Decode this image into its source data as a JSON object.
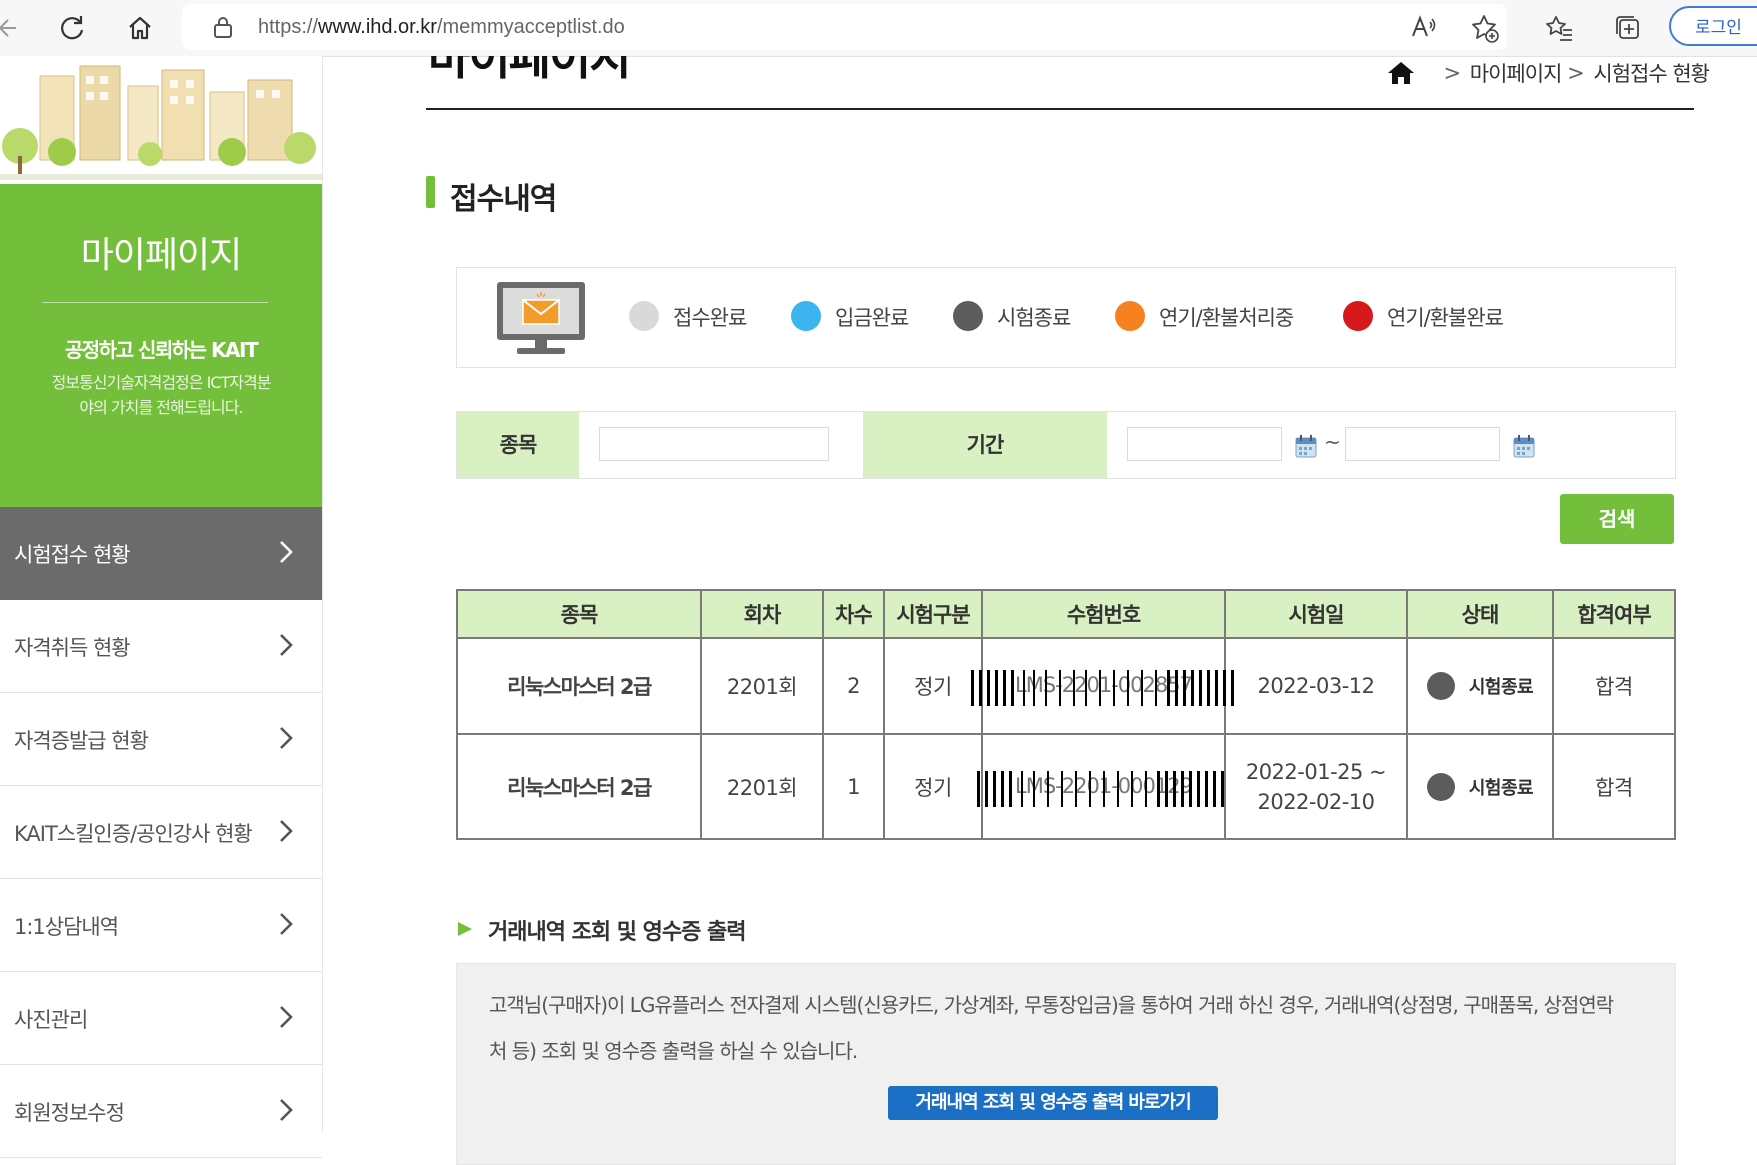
{
  "browser": {
    "url_prefix": "https://",
    "url_domain": "www.ihd.or.kr",
    "url_path": "/memmyacceptlist.do",
    "login_label": "로그인"
  },
  "sidebar": {
    "title": "마이페이지",
    "slogan": "공정하고 신뢰하는 KAIT",
    "desc": "정보통신기술자격검정은 ICT자격분야의 가치를 전해드립니다.",
    "items": [
      {
        "label": "시험접수 현황",
        "active": true
      },
      {
        "label": "자격취득 현황",
        "active": false
      },
      {
        "label": "자격증발급 현황",
        "active": false
      },
      {
        "label": "KAIT스킬인증/공인강사 현황",
        "active": false
      },
      {
        "label": "1:1상담내역",
        "active": false
      },
      {
        "label": "사진관리",
        "active": false
      },
      {
        "label": "회원정보수정",
        "active": false
      }
    ]
  },
  "main": {
    "page_title": "마이페이지",
    "breadcrumb": [
      "마이페이지",
      "시험접수 현황"
    ],
    "section_title": "접수내역",
    "legend": [
      {
        "label": "접수완료",
        "color": "#d9d9d9"
      },
      {
        "label": "입금완료",
        "color": "#3cb4f0"
      },
      {
        "label": "시험종료",
        "color": "#5c5c5c"
      },
      {
        "label": "연기/환불처리중",
        "color": "#f5821f"
      },
      {
        "label": "연기/환불완료",
        "color": "#d7191c"
      }
    ],
    "search": {
      "subject_label": "종목",
      "subject_value": "",
      "period_label": "기간",
      "date_from": "",
      "date_to": "",
      "tilde": "~",
      "button_label": "검색"
    },
    "table": {
      "headers": [
        "종목",
        "회차",
        "차수",
        "시험구분",
        "수험번호",
        "시험일",
        "상태",
        "합격여부"
      ],
      "rows": [
        {
          "subject": "리눅스마스터 2급",
          "round": "2201회",
          "order": "2",
          "type": "정기",
          "exam_no": "LMS-2201-002857",
          "date_line1": "2022-03-12",
          "date_line2": "",
          "status": "시험종료",
          "result": "합격"
        },
        {
          "subject": "리눅스마스터 2급",
          "round": "2201회",
          "order": "1",
          "type": "정기",
          "exam_no": "LMS-2201-000129",
          "date_line1": "2022-01-25 ~",
          "date_line2": "2022-02-10",
          "status": "시험종료",
          "result": "합격"
        }
      ]
    },
    "receipt": {
      "heading": "거래내역 조회 및 영수증 출력",
      "text": "고객님(구매자)이 LG유플러스 전자결제 시스템(신용카드, 가상계좌, 무통장입금)을 통하여 거래 하신 경우, 거래내역(상점명, 구매품목, 상점연락처 등) 조회 및 영수증 출력을 하실 수 있습니다.",
      "button_label": "거래내역 조회 및 영수증 출력 바로가기"
    }
  }
}
